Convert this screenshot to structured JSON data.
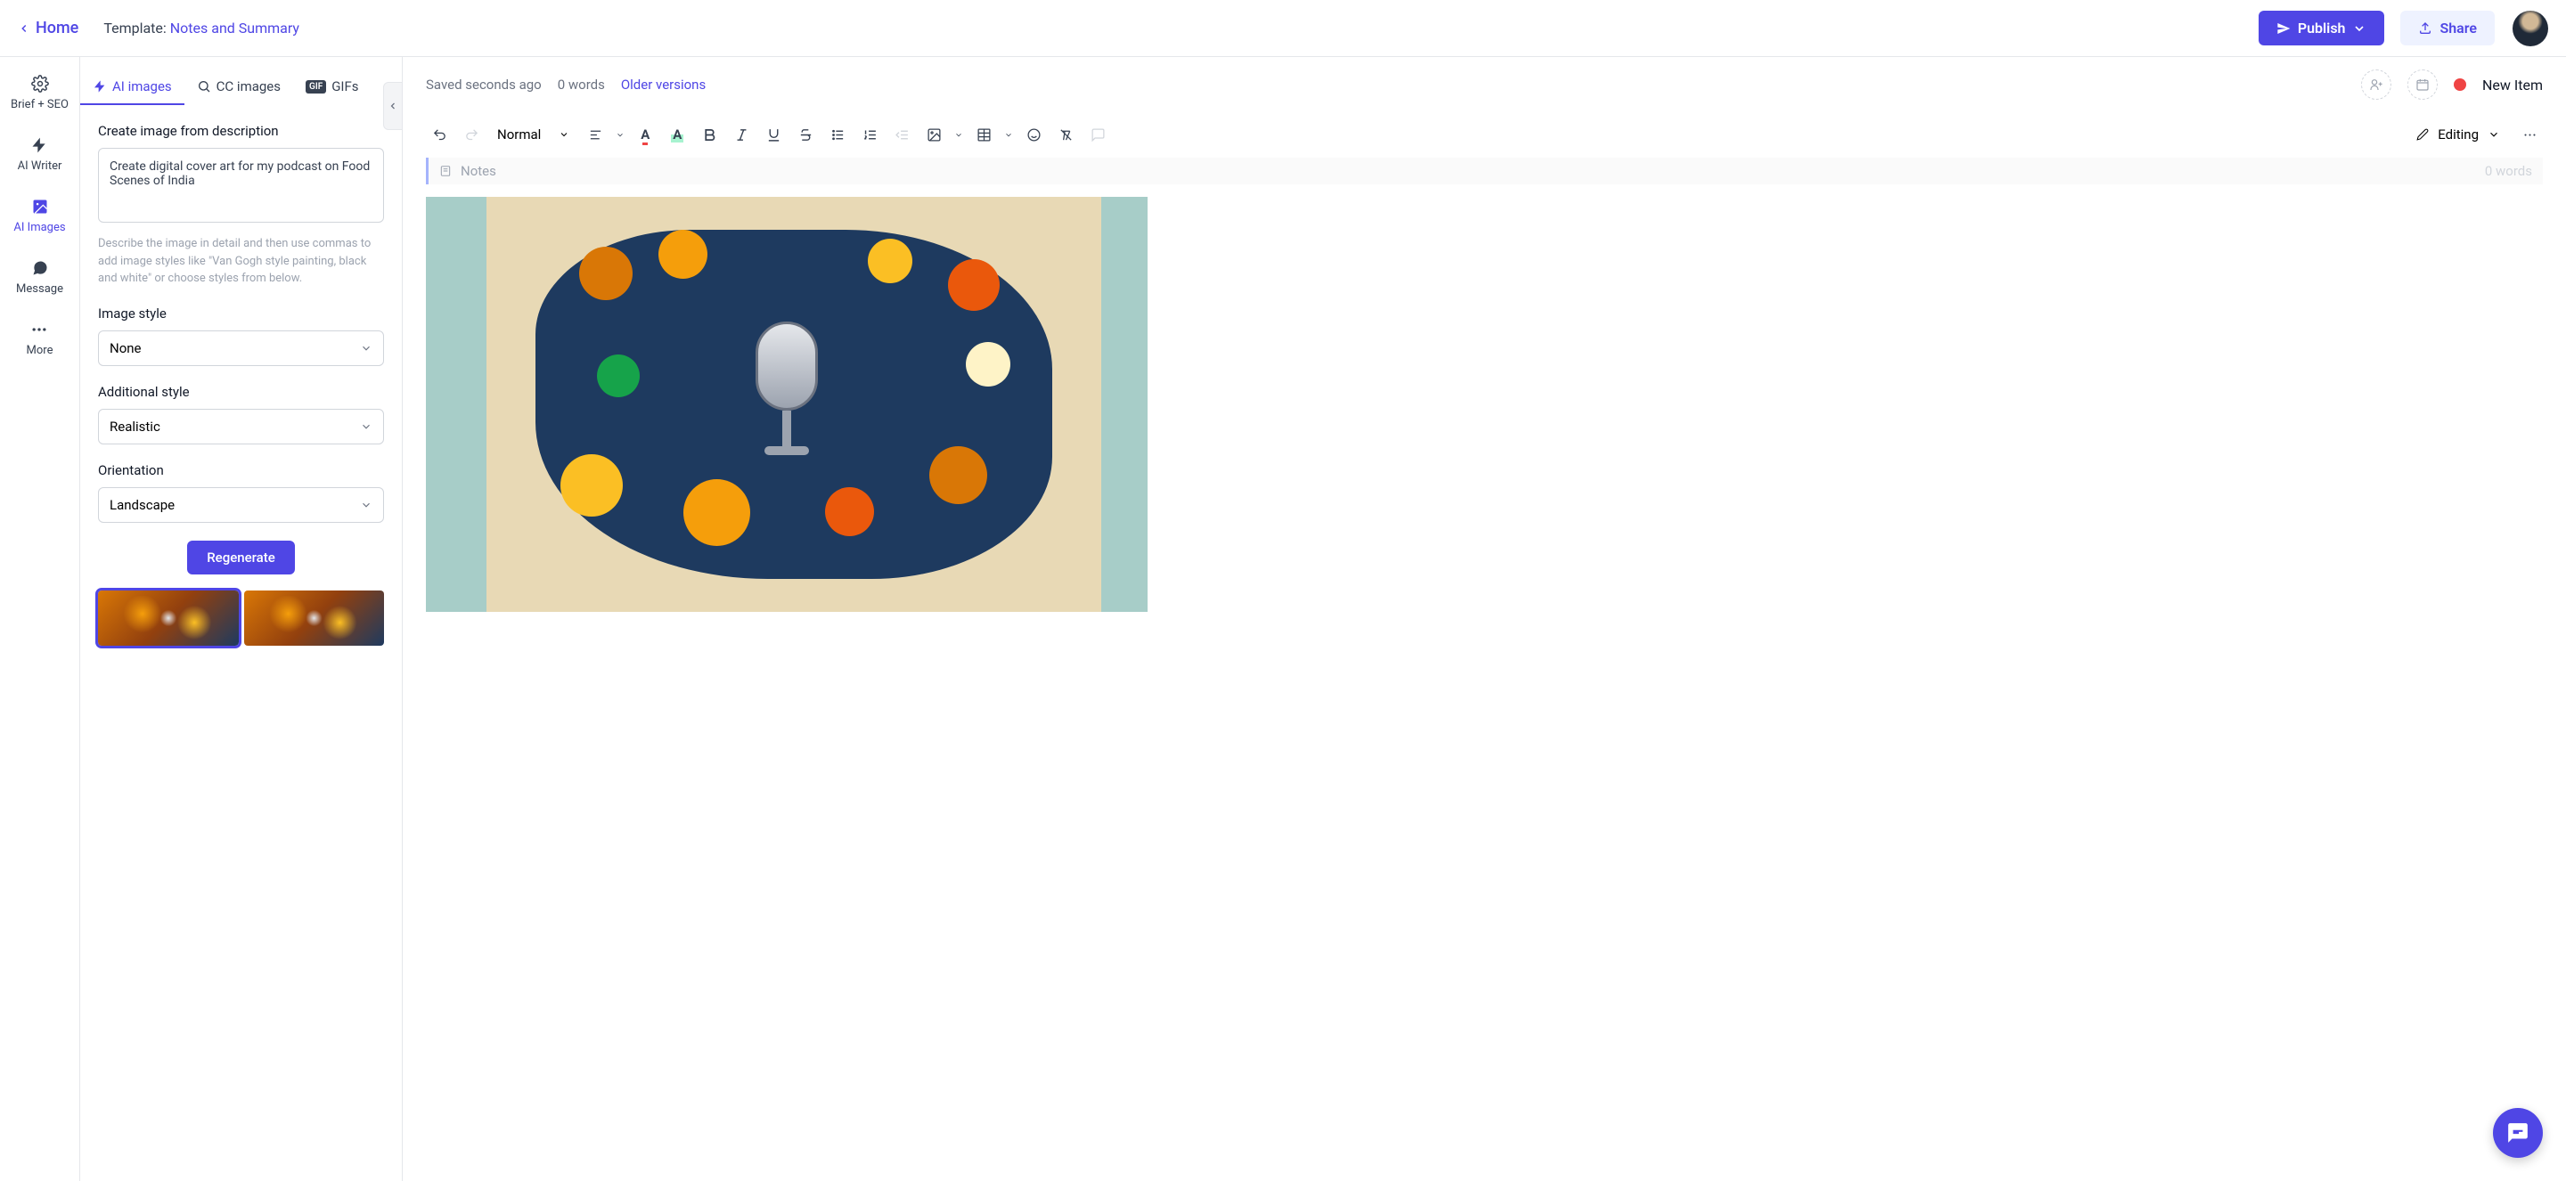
{
  "topbar": {
    "home": "Home",
    "template_prefix": "Template: ",
    "template_name": "Notes and Summary",
    "publish": "Publish",
    "share": "Share"
  },
  "rail": {
    "items": [
      {
        "label": "Brief + SEO"
      },
      {
        "label": "AI Writer"
      },
      {
        "label": "AI Images"
      },
      {
        "label": "Message"
      },
      {
        "label": "More"
      }
    ]
  },
  "panel": {
    "tabs": {
      "ai_images": "AI images",
      "cc_images": "CC images",
      "gifs_badge": "GIF",
      "gifs": "GIFs"
    },
    "create_label": "Create image from description",
    "prompt_value": "Create digital cover art for my podcast on Food Scenes of India",
    "helper": "Describe the image in detail and then use commas to add image styles like \"Van Gogh style painting, black and white\" or choose styles from below.",
    "style_label": "Image style",
    "style_value": "None",
    "additional_label": "Additional style",
    "additional_value": "Realistic",
    "orientation_label": "Orientation",
    "orientation_value": "Landscape",
    "regenerate": "Regenerate"
  },
  "editor": {
    "saved": "Saved seconds ago",
    "words": "0 words",
    "versions": "Older versions",
    "status": "New Item",
    "style_select": "Normal",
    "mode": "Editing",
    "notes_label": "Notes",
    "notes_words": "0 words"
  }
}
